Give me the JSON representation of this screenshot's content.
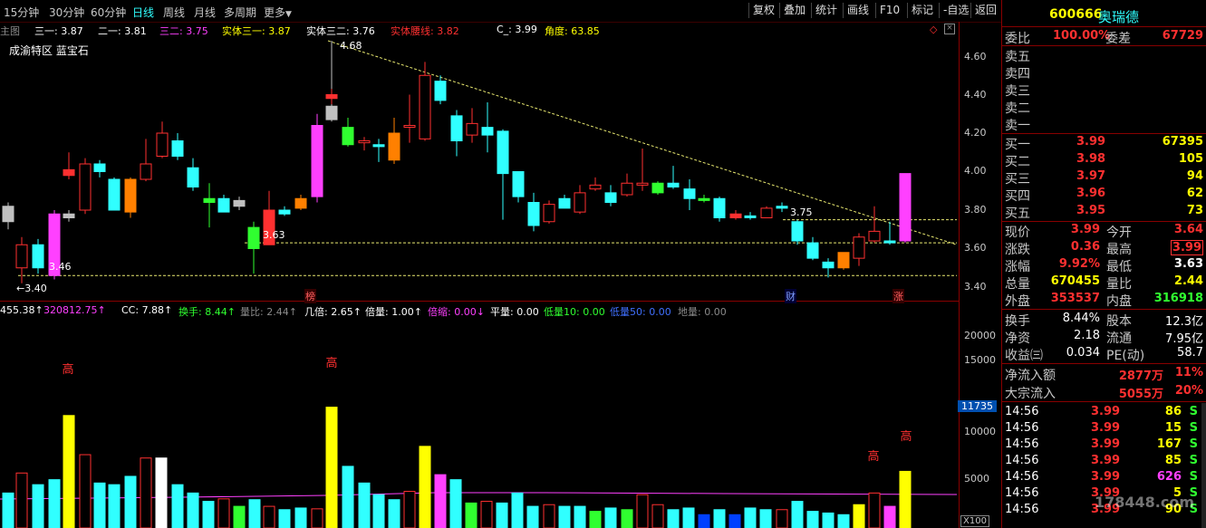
{
  "toolbar": {
    "periods": [
      "15分钟",
      "30分钟",
      "60分钟",
      "日线",
      "周线",
      "月线",
      "多周期",
      "更多"
    ],
    "active": "日线",
    "right": [
      "复权",
      "叠加",
      "统计",
      "画线",
      "F10",
      "标记",
      "-自选",
      "返回"
    ]
  },
  "stock": {
    "code": "600666",
    "name": "奥瑞德"
  },
  "main_indicator": {
    "label": "主图",
    "items": [
      "三一: 3.87",
      "二一: 3.81",
      "三二: 3.75",
      "实体三一: 3.87",
      "实体三二: 3.76",
      "实体腰线: 3.82",
      "C_: 3.99",
      "角度: 63.85"
    ],
    "region": "成渝特区 蓝宝石"
  },
  "price_axis": [
    "4.60",
    "4.40",
    "4.20",
    "4.00",
    "3.80",
    "3.60",
    "3.40"
  ],
  "chart_annotations": {
    "high": "4.68",
    "low": "←3.40",
    "h_line1": "3.75",
    "h_line2": "3.63",
    "label_346": "3.46"
  },
  "event_tags": [
    "榜",
    "财",
    "涨"
  ],
  "volume_indicator": {
    "items": [
      "455.38↑",
      "320812.75↑",
      "CC: 7.88↑",
      "换手: 8.44↑",
      "量比: 2.44↑",
      "几倍: 2.65↑",
      "倍量: 1.00↑",
      "倍缩: 0.00↓",
      "平量: 0.00",
      "低量10: 0.00",
      "低量50: 0.00",
      "地量: 0.00"
    ]
  },
  "volume_axis": [
    "20000",
    "15000",
    "10000",
    "5000"
  ],
  "volume_marker": "11735",
  "volume_unit": "X100",
  "volume_labels": {
    "high": "高"
  },
  "order_book": {
    "wei_bi_label": "委比",
    "wei_bi": "100.00%",
    "wei_cha_label": "委差",
    "wei_cha": "67729",
    "sells": [
      {
        "label": "卖五",
        "price": "",
        "vol": ""
      },
      {
        "label": "卖四",
        "price": "",
        "vol": ""
      },
      {
        "label": "卖三",
        "price": "",
        "vol": ""
      },
      {
        "label": "卖二",
        "price": "",
        "vol": ""
      },
      {
        "label": "卖一",
        "price": "",
        "vol": ""
      }
    ],
    "buys": [
      {
        "label": "买一",
        "price": "3.99",
        "vol": "67395"
      },
      {
        "label": "买二",
        "price": "3.98",
        "vol": "105"
      },
      {
        "label": "买三",
        "price": "3.97",
        "vol": "94"
      },
      {
        "label": "买四",
        "price": "3.96",
        "vol": "62"
      },
      {
        "label": "买五",
        "price": "3.95",
        "vol": "73"
      }
    ]
  },
  "quote": {
    "rows": [
      [
        "现价",
        "3.99",
        "今开",
        "3.64"
      ],
      [
        "涨跌",
        "0.36",
        "最高",
        "3.99"
      ],
      [
        "涨幅",
        "9.92%",
        "最低",
        "3.63"
      ],
      [
        "总量",
        "670455",
        "量比",
        "2.44"
      ],
      [
        "外盘",
        "353537",
        "内盘",
        "316918"
      ]
    ],
    "rows2": [
      [
        "换手",
        "8.44%",
        "股本",
        "12.3亿"
      ],
      [
        "净资",
        "2.18",
        "流通",
        "7.95亿"
      ],
      [
        "收益㈢",
        "0.034",
        "PE(动)",
        "58.7"
      ]
    ],
    "flow": [
      [
        "净流入额",
        "2877万",
        "11%"
      ],
      [
        "大宗流入",
        "5055万",
        "20%"
      ]
    ]
  },
  "ticks": [
    [
      "14:56",
      "3.99",
      "86",
      "S"
    ],
    [
      "14:56",
      "3.99",
      "15",
      "S"
    ],
    [
      "14:56",
      "3.99",
      "167",
      "S"
    ],
    [
      "14:56",
      "3.99",
      "85",
      "S"
    ],
    [
      "14:56",
      "3.99",
      "626",
      "S"
    ],
    [
      "14:56",
      "3.99",
      "5",
      "S"
    ],
    [
      "14:56",
      "3.99",
      "90",
      "S"
    ]
  ],
  "watermark": "178448.com"
}
